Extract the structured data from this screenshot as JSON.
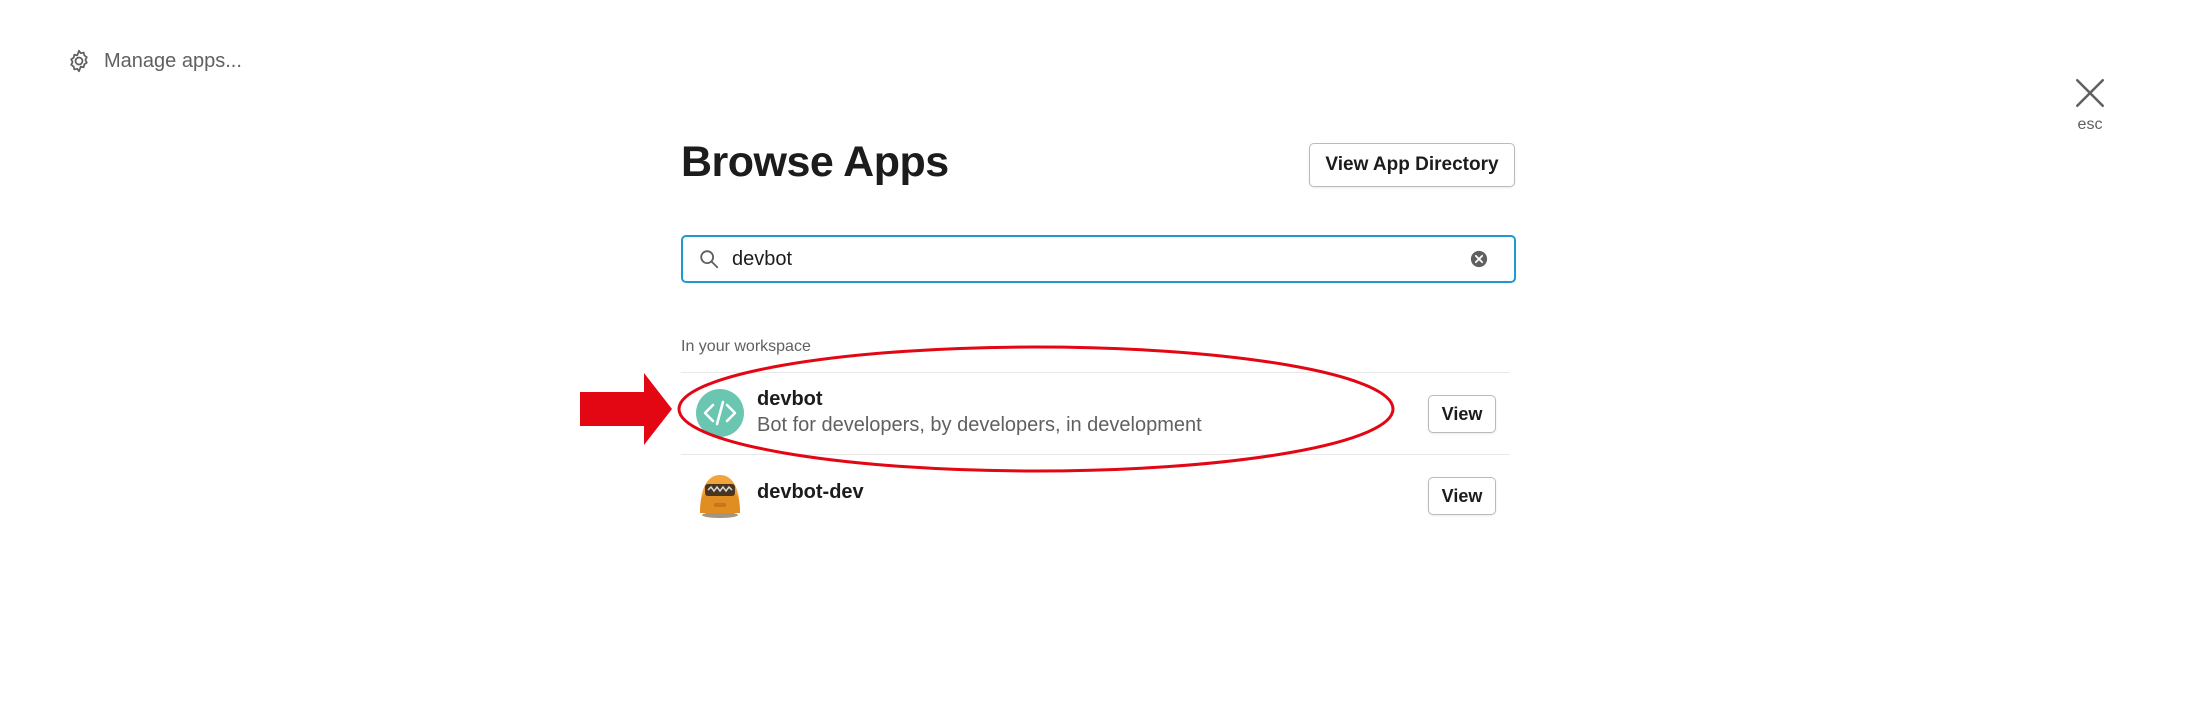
{
  "header": {
    "manage_apps_label": "Manage apps...",
    "close_label": "esc",
    "title": "Browse Apps",
    "view_directory_label": "View App Directory"
  },
  "search": {
    "value": "devbot",
    "placeholder": ""
  },
  "section": {
    "label": "In your workspace"
  },
  "apps": [
    {
      "name": "devbot",
      "description": "Bot for developers, by developers, in development",
      "icon": "code-icon",
      "icon_color": "#6ac6b1",
      "view_label": "View"
    },
    {
      "name": "devbot-dev",
      "description": "",
      "icon": "robot-icon",
      "icon_color": "#f2a33a",
      "view_label": "View"
    }
  ],
  "annotations": {
    "highlight_color": "#e30613",
    "arrow_icon": "arrow-right-icon",
    "ellipse": "highlight-ellipse"
  }
}
